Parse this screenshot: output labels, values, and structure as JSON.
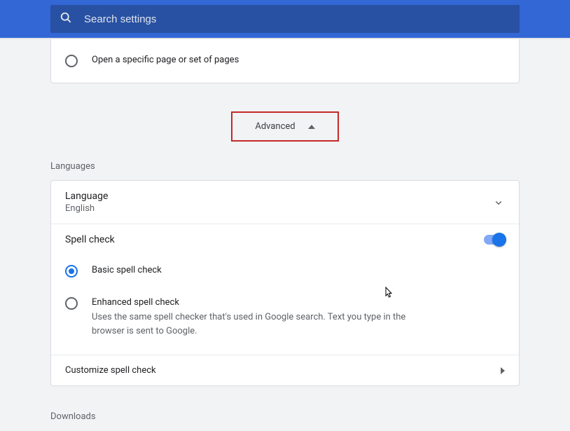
{
  "header": {
    "search_placeholder": "Search settings"
  },
  "startup": {
    "option_specific": "Open a specific page or set of pages"
  },
  "advanced": {
    "label": "Advanced"
  },
  "sections": {
    "languages_title": "Languages",
    "downloads_title": "Downloads"
  },
  "language_row": {
    "title": "Language",
    "value": "English"
  },
  "spellcheck": {
    "title": "Spell check",
    "enabled": true,
    "basic_label": "Basic spell check",
    "enhanced_label": "Enhanced spell check",
    "enhanced_desc": "Uses the same spell checker that's used in Google search. Text you type in the browser is sent to Google.",
    "customize_label": "Customize spell check"
  }
}
